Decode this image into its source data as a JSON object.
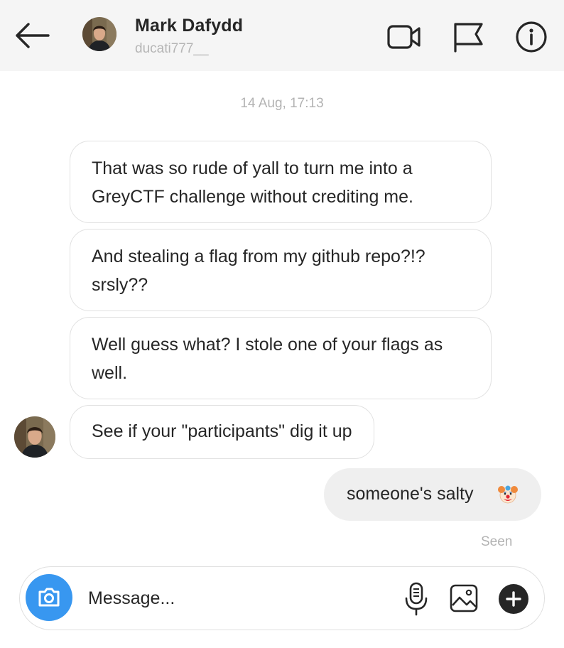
{
  "header": {
    "name": "Mark Dafydd",
    "username": "ducati777__",
    "icons": [
      "back-arrow-icon",
      "video-call-icon",
      "flag-icon",
      "info-icon"
    ]
  },
  "conversation": {
    "timestamp": "14 Aug, 17:13",
    "received": [
      {
        "text": "That was so rude of yall to turn me into a GreyCTF challenge without crediting me."
      },
      {
        "text": "And stealing a flag from my github repo?!? srsly??"
      },
      {
        "text": "Well guess what? I stole one of your flags as well."
      },
      {
        "text": "See if your \"participants\" dig it up"
      }
    ],
    "sent": [
      {
        "text": "someone's salty",
        "emoji": "clown-face-emoji"
      }
    ],
    "status": "Seen"
  },
  "composer": {
    "placeholder": "Message...",
    "icons": [
      "camera-icon",
      "microphone-icon",
      "gallery-icon",
      "plus-icon"
    ]
  },
  "colors": {
    "accent": "#3897f0",
    "header_bg": "#f5f5f5",
    "sent_bubble": "#efefef",
    "bubble_border": "#e1e1e1",
    "muted_text": "#b3b3b3"
  }
}
